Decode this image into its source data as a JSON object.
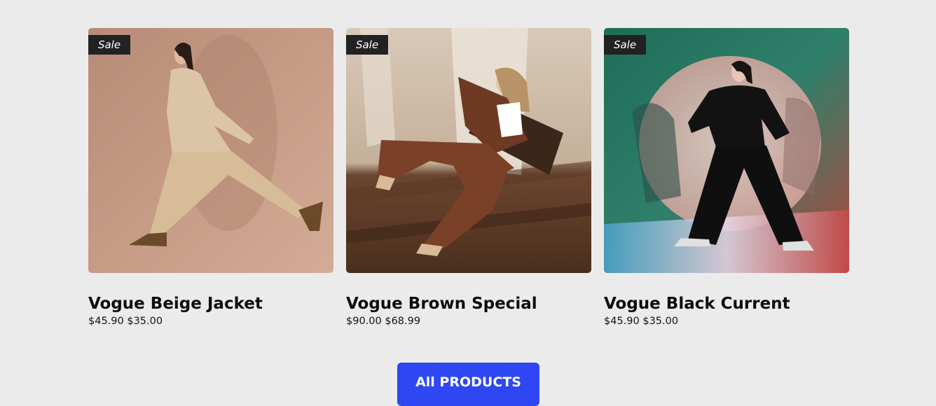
{
  "products": [
    {
      "badge": "Sale",
      "name": "Vogue Beige Jacket",
      "price_old": "$45.90",
      "price_new": "$35.00"
    },
    {
      "badge": "Sale",
      "name": "Vogue Brown Special",
      "price_old": "$90.00",
      "price_new": "$68.99"
    },
    {
      "badge": "Sale",
      "name": "Vogue Black Current",
      "price_old": "$45.90",
      "price_new": "$35.00"
    }
  ],
  "cta": {
    "label": "All PRODUCTS"
  },
  "colors": {
    "background": "#ebebeb",
    "button": "#2e47f2",
    "badge": "#222222"
  }
}
